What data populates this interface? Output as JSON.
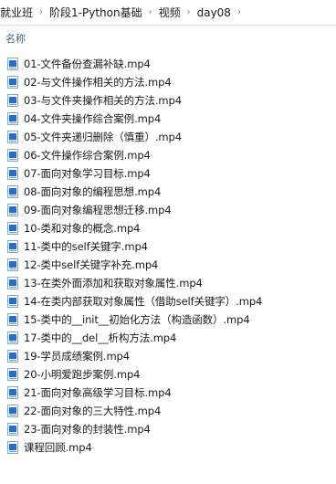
{
  "breadcrumb": {
    "items": [
      "就业班",
      "阶段1-Python基础",
      "视频",
      "day08"
    ]
  },
  "header": {
    "name_label": "名称",
    "sort_indicator": "^"
  },
  "files": [
    {
      "name": "01-文件备份查漏补缺.mp4",
      "icon": "video-file-icon"
    },
    {
      "name": "02-与文件操作相关的方法.mp4",
      "icon": "video-file-icon"
    },
    {
      "name": "03-与文件夹操作相关的方法.mp4",
      "icon": "video-file-icon"
    },
    {
      "name": "04-文件夹操作综合案例.mp4",
      "icon": "video-file-icon"
    },
    {
      "name": "05-文件夹递归删除（慎重）.mp4",
      "icon": "video-file-icon"
    },
    {
      "name": "06-文件操作综合案例.mp4",
      "icon": "video-file-icon"
    },
    {
      "name": "07-面向对象学习目标.mp4",
      "icon": "video-file-icon"
    },
    {
      "name": "08-面向对象的编程思想.mp4",
      "icon": "video-file-icon"
    },
    {
      "name": "09-面向对象编程思想迁移.mp4",
      "icon": "video-file-icon"
    },
    {
      "name": "10-类和对象的概念.mp4",
      "icon": "video-file-icon"
    },
    {
      "name": "11-类中的self关键字.mp4",
      "icon": "video-file-icon"
    },
    {
      "name": "12-类中self关键字补充.mp4",
      "icon": "video-file-icon"
    },
    {
      "name": "13-在类外面添加和获取对象属性.mp4",
      "icon": "video-file-icon"
    },
    {
      "name": "14-在类内部获取对象属性（借助self关键字）.mp4",
      "icon": "video-file-icon"
    },
    {
      "name": "15-类中的__init__初始化方法（构造函数）.mp4",
      "icon": "video-file-icon"
    },
    {
      "name": "17-类中的__del__析构方法.mp4",
      "icon": "video-file-icon"
    },
    {
      "name": "19-学员成绩案例.mp4",
      "icon": "video-file-icon"
    },
    {
      "name": "20-小明爱跑步案例.mp4",
      "icon": "video-file-icon"
    },
    {
      "name": "21-面向对象高级学习目标.mp4",
      "icon": "video-file-icon"
    },
    {
      "name": "22-面向对象的三大特性.mp4",
      "icon": "video-file-icon"
    },
    {
      "name": "23-面向对象的封装性.mp4",
      "icon": "video-file-icon"
    },
    {
      "name": "课程回顾.mp4",
      "icon": "video-file-icon"
    }
  ],
  "colors": {
    "icon_blue": "#2b6cc4",
    "icon_frame": "#7fa7d8",
    "header_text": "#4c607a"
  }
}
